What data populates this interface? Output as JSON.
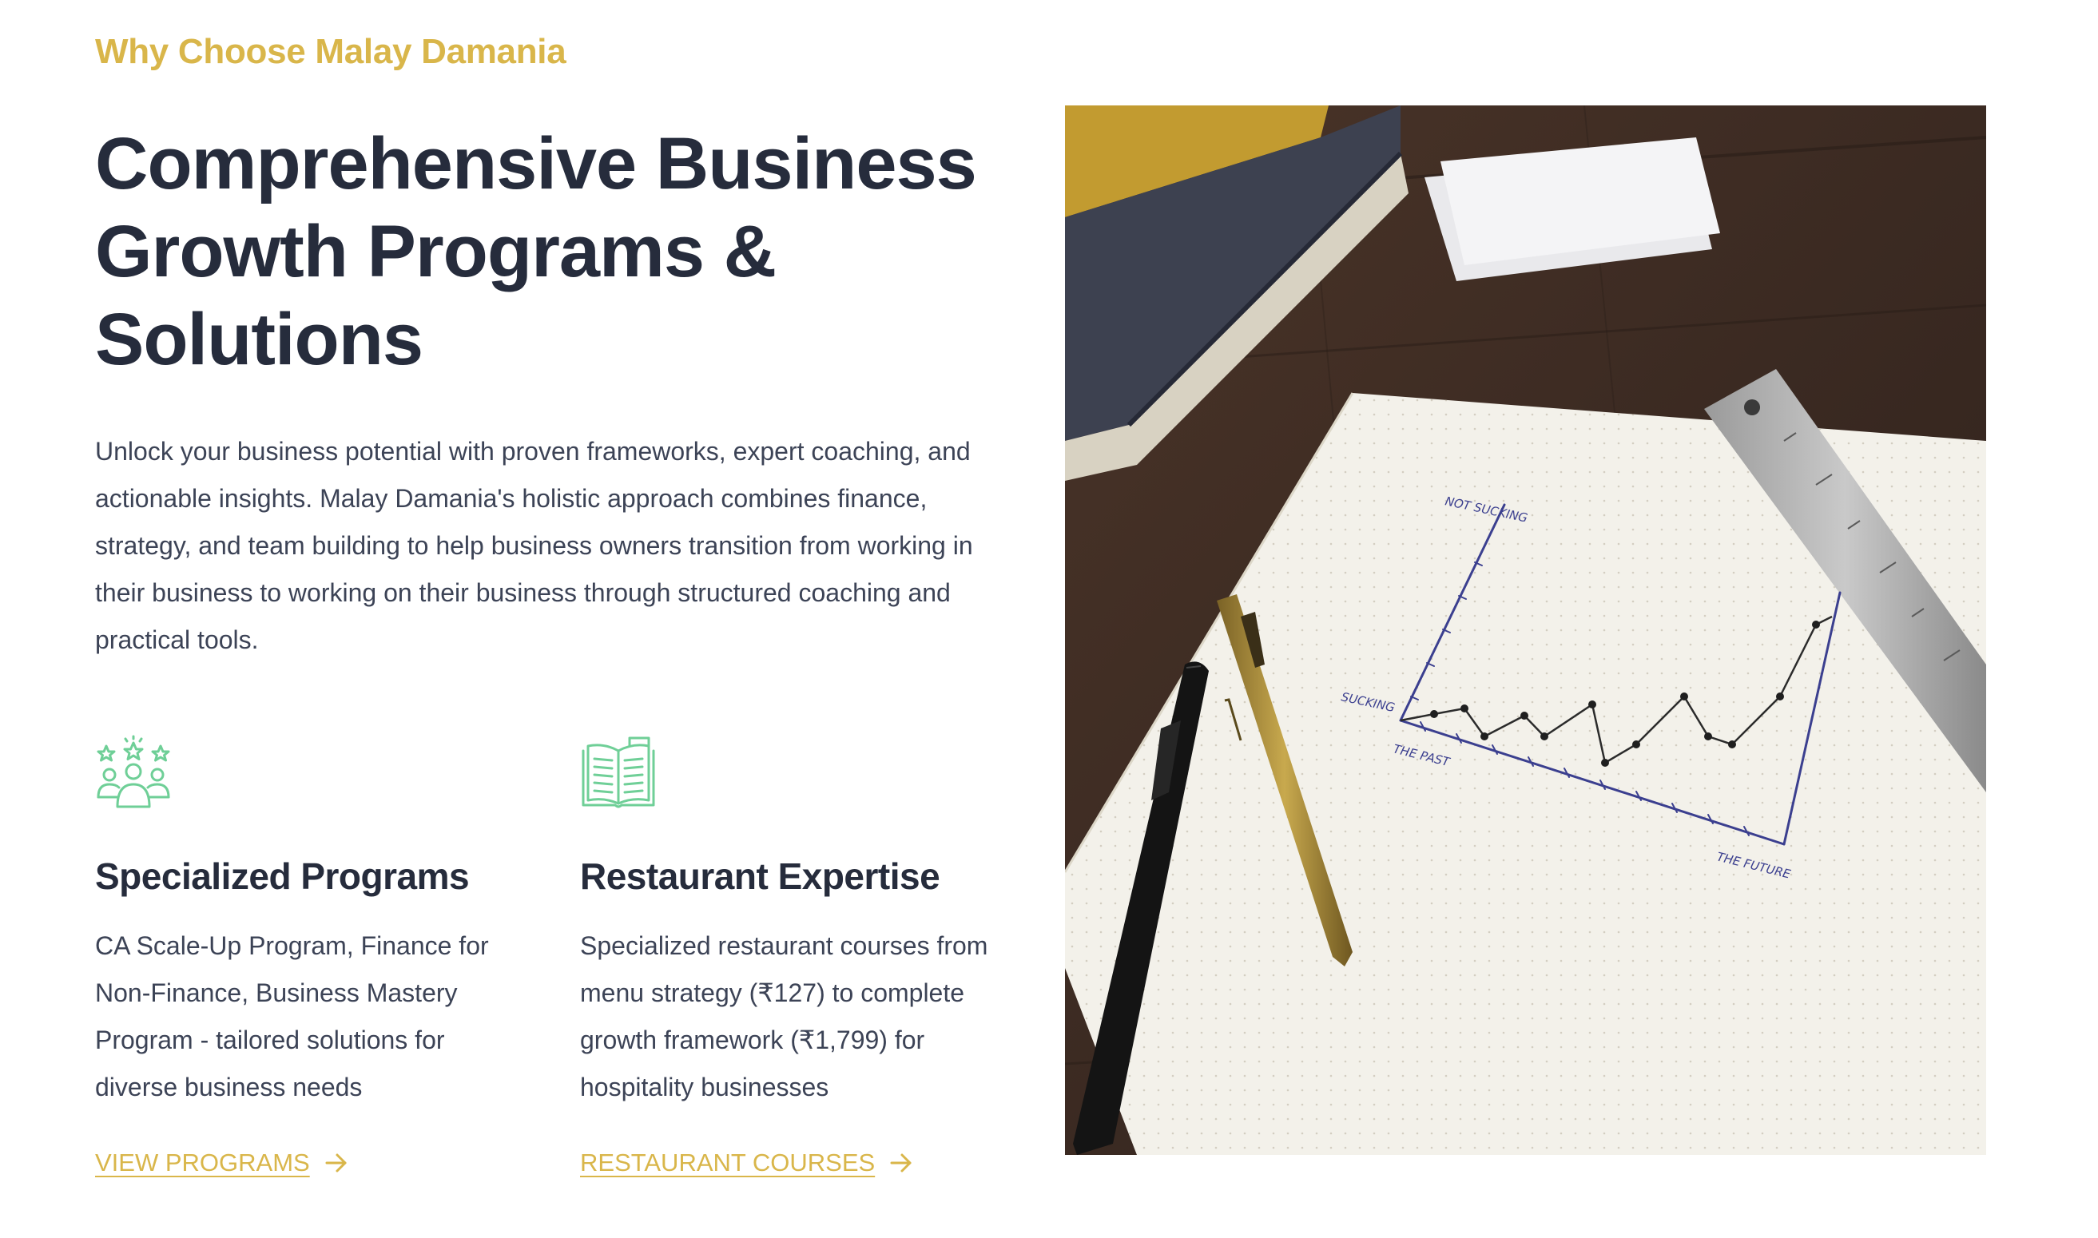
{
  "section": {
    "eyebrow": "Why Choose Malay Damania",
    "title": "Comprehensive Business Growth Programs & Solutions",
    "description": "Unlock your business potential with proven frameworks, expert coaching, and actionable insights. Malay Damania's holistic approach combines finance, strategy, and team building to help business owners transition from working in their business to working on their business through structured coaching and practical tools."
  },
  "features": [
    {
      "icon": "team-stars-icon",
      "title": "Specialized Programs",
      "text": "CA Scale-Up Program, Finance for Non-Finance, Business Mastery Program - tailored solutions for diverse business needs",
      "link_label": "VIEW PROGRAMS"
    },
    {
      "icon": "open-book-icon",
      "title": "Restaurant Expertise",
      "text": "Specialized restaurant courses from menu strategy (₹127) to complete growth framework (₹1,799) for hospitality businesses",
      "link_label": "RESTAURANT COURSES"
    }
  ],
  "image": {
    "subject": "notebook with hand-drawn growth chart, pens and ruler on wooden desk",
    "sketch_labels": {
      "top_axis": "NOT SUCKING",
      "left_axis": "SUCKING",
      "x_start": "THE PAST",
      "x_end": "THE FUTURE"
    }
  },
  "colors": {
    "accent_gold": "#d9b64a",
    "heading": "#262c3c",
    "body_text": "#3c4356",
    "icon_green": "#6fcf97"
  }
}
